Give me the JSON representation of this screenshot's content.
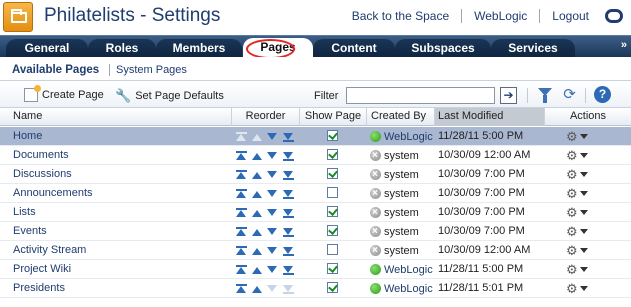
{
  "header": {
    "title": "Philatelists - Settings",
    "links": [
      "Back to the Space",
      "WebLogic",
      "Logout"
    ],
    "oracle_icon": "oracle-logo-icon"
  },
  "tabs": [
    {
      "label": "General",
      "active": false
    },
    {
      "label": "Roles",
      "active": false
    },
    {
      "label": "Members",
      "active": false
    },
    {
      "label": "Pages",
      "active": true
    },
    {
      "label": "Content",
      "active": false
    },
    {
      "label": "Subspaces",
      "active": false
    },
    {
      "label": "Services",
      "active": false
    }
  ],
  "tab_overflow": "»",
  "subnav": {
    "current": "Available Pages",
    "other": "System Pages"
  },
  "toolbar": {
    "create_label": "Create Page",
    "defaults_label": "Set Page Defaults",
    "filter_label": "Filter",
    "filter_value": "",
    "go_icon": "➔"
  },
  "columns": {
    "name": "Name",
    "reorder": "Reorder",
    "show": "Show Page",
    "created": "Created By",
    "modified": "Last Modified",
    "actions": "Actions"
  },
  "rows": [
    {
      "name": "Home",
      "show": true,
      "creator": "WebLogic",
      "creator_status": "green",
      "modified": "11/28/11 5:00 PM",
      "selected": true
    },
    {
      "name": "Documents",
      "show": true,
      "creator": "system",
      "creator_status": "gray",
      "modified": "10/30/09 12:00 AM",
      "selected": false
    },
    {
      "name": "Discussions",
      "show": true,
      "creator": "system",
      "creator_status": "gray",
      "modified": "10/30/09 7:00 PM",
      "selected": false
    },
    {
      "name": "Announcements",
      "show": false,
      "creator": "system",
      "creator_status": "gray",
      "modified": "10/30/09 7:00 PM",
      "selected": false
    },
    {
      "name": "Lists",
      "show": true,
      "creator": "system",
      "creator_status": "gray",
      "modified": "10/30/09 7:00 PM",
      "selected": false
    },
    {
      "name": "Events",
      "show": true,
      "creator": "system",
      "creator_status": "gray",
      "modified": "10/30/09 7:00 PM",
      "selected": false
    },
    {
      "name": "Activity Stream",
      "show": false,
      "creator": "system",
      "creator_status": "gray",
      "modified": "10/30/09 12:00 AM",
      "selected": false
    },
    {
      "name": "Project Wiki",
      "show": true,
      "creator": "WebLogic",
      "creator_status": "green",
      "modified": "11/28/11 5:00 PM",
      "selected": false
    },
    {
      "name": "Presidents",
      "show": true,
      "creator": "WebLogic",
      "creator_status": "green",
      "modified": "11/28/11 5:01 PM",
      "selected": false
    }
  ],
  "colors": {
    "header_text": "#1f3d6e",
    "tabbar": "#1b3657",
    "selected_row": "#a9b8d0",
    "highlight_circle": "#e32626"
  }
}
